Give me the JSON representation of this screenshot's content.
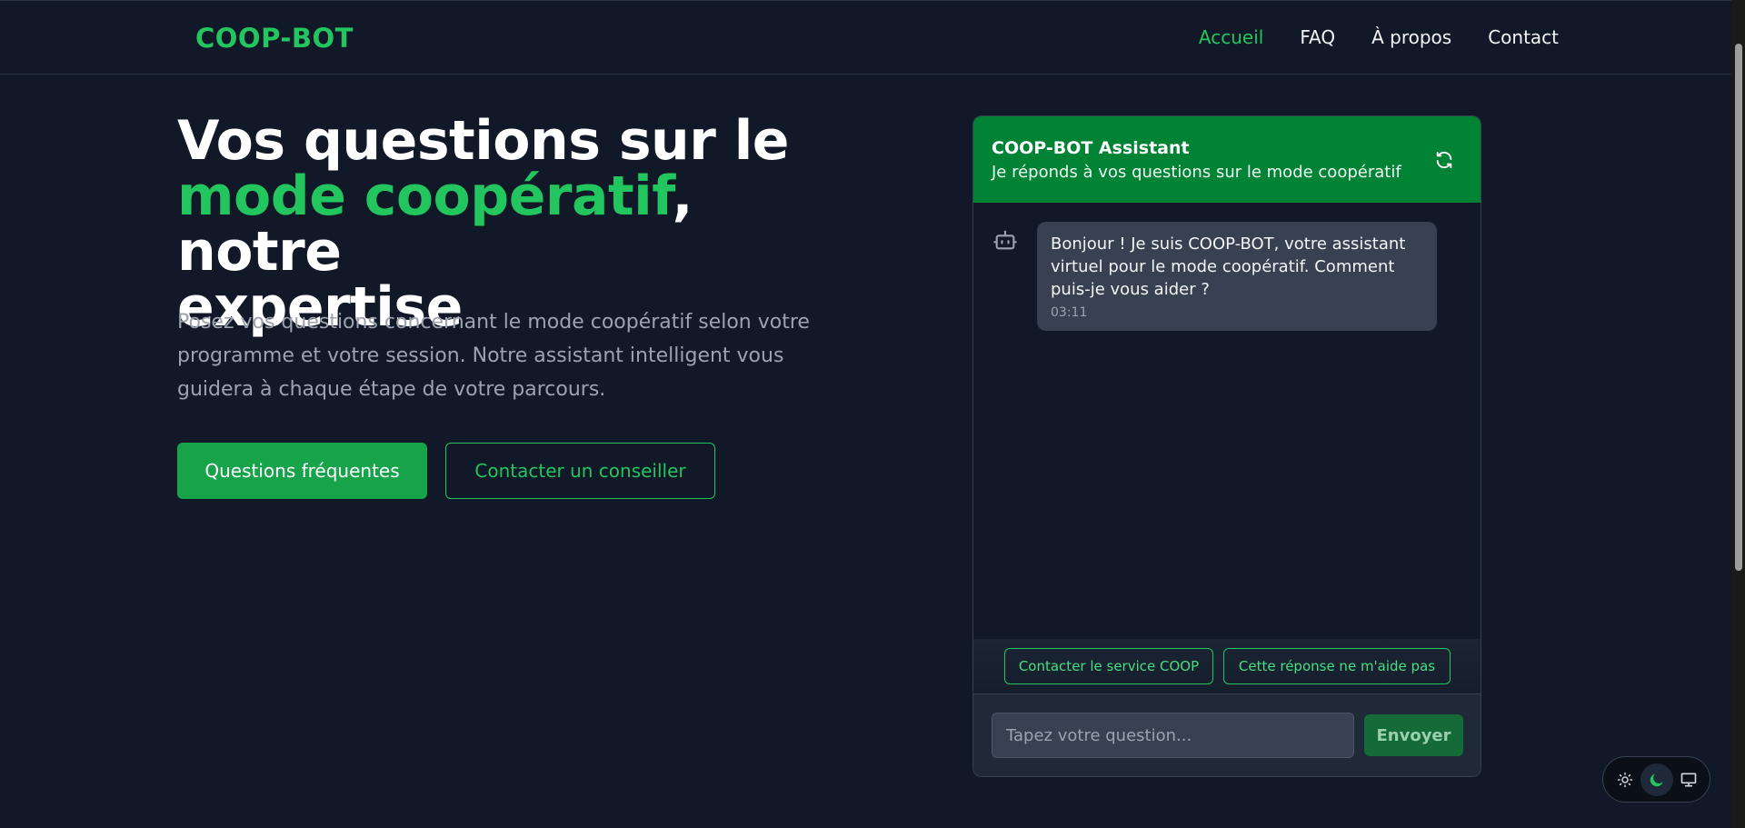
{
  "header": {
    "logo": "COOP-BOT",
    "nav": [
      {
        "label": "Accueil"
      },
      {
        "label": "FAQ"
      },
      {
        "label": "À propos"
      },
      {
        "label": "Contact"
      }
    ]
  },
  "hero": {
    "title_line1": "Vos questions sur le",
    "title_accent": "mode coopératif",
    "title_after_accent": ", notre",
    "title_line3": "expertise",
    "subtitle": "Posez vos questions concernant le mode coopératif selon votre programme et votre session. Notre assistant intelligent vous guidera à chaque étape de votre parcours.",
    "primary_button": "Questions fréquentes",
    "secondary_button": "Contacter un conseiller"
  },
  "chat": {
    "title": "COOP-BOT Assistant",
    "subtitle": "Je réponds à vos questions sur le mode coopératif",
    "refresh_icon": "refresh-icon",
    "messages": [
      {
        "sender_icon": "robot-icon",
        "text": "Bonjour ! Je suis COOP-BOT, votre assistant virtuel pour le mode coopératif. Comment puis-je vous aider ?",
        "time": "03:11"
      }
    ],
    "quick_replies": [
      "Contacter le service COOP",
      "Cette réponse ne m'aide pas"
    ],
    "input_placeholder": "Tapez votre question...",
    "input_value": "",
    "send_label": "Envoyer"
  },
  "theme_toggle": {
    "options": [
      "sun-icon",
      "moon-icon",
      "monitor-icon"
    ],
    "selected": "moon-icon"
  },
  "colors": {
    "background": "#111827",
    "accent": "#22c55e",
    "chat_header": "#008334",
    "bubble": "#374151"
  }
}
